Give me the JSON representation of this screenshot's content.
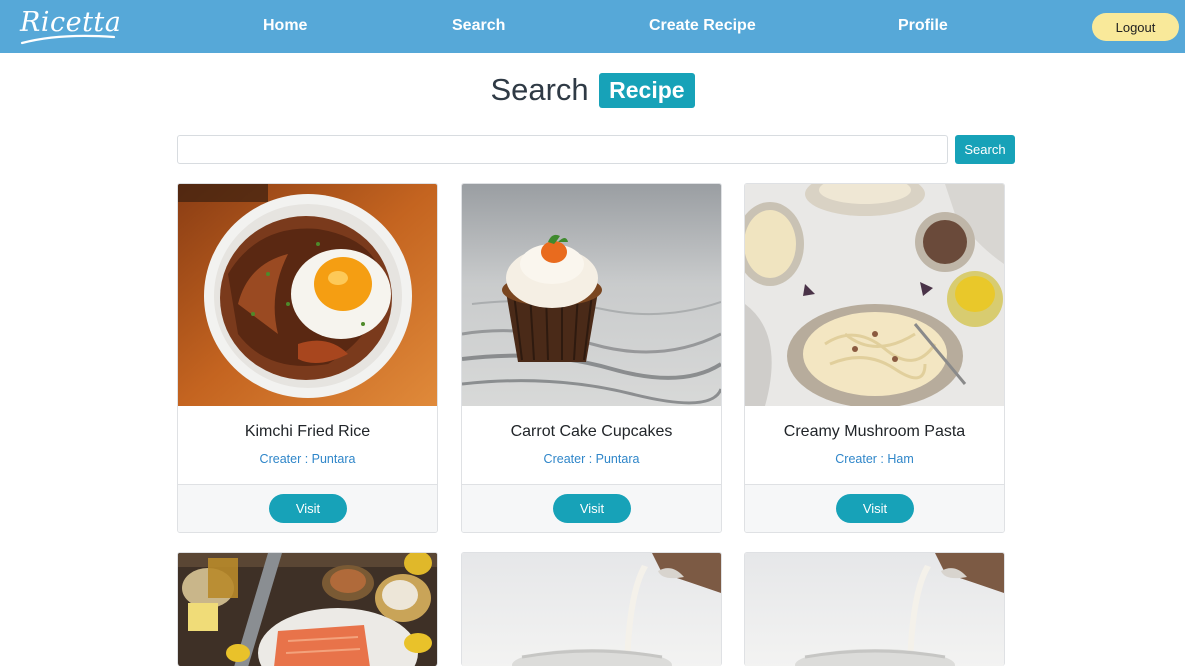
{
  "app": {
    "logo_text": "Ricetta"
  },
  "nav": {
    "home": "Home",
    "search": "Search",
    "create_recipe": "Create Recipe",
    "profile": "Profile",
    "logout": "Logout"
  },
  "page": {
    "title_main": "Search",
    "title_badge": "Recipe"
  },
  "search": {
    "value": "",
    "placeholder": "",
    "button": "Search"
  },
  "recipes": [
    {
      "title": "Kimchi Fried Rice",
      "creator": "Creater : Puntara",
      "visit": "Visit",
      "image": "kimchi-fried-rice-photo"
    },
    {
      "title": "Carrot Cake Cupcakes",
      "creator": "Creater : Puntara",
      "visit": "Visit",
      "image": "carrot-cake-cupcake-photo"
    },
    {
      "title": "Creamy Mushroom Pasta",
      "creator": "Creater : Ham",
      "visit": "Visit",
      "image": "creamy-mushroom-pasta-photo"
    },
    {
      "image": "salmon-ingredients-photo"
    },
    {
      "image": "milk-pouring-photo"
    },
    {
      "image": "milk-pouring-photo"
    }
  ],
  "colors": {
    "navbar": "#56a8d8",
    "accent": "#17a2b8",
    "logout": "#f9e99a",
    "creator_text": "#2f86c9"
  }
}
